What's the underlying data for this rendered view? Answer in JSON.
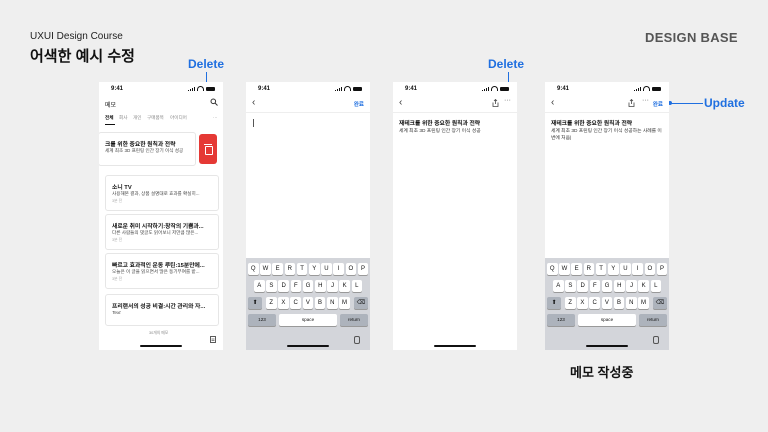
{
  "header": {
    "course": "UXUI Design Course",
    "title": "어색한 예시 수정",
    "brand": "DESIGN BASE"
  },
  "caption": "메모 작성중",
  "callouts": {
    "delete_1": "Delete",
    "delete_2": "Delete",
    "update": "Update"
  },
  "status_time": "9:41",
  "screen1": {
    "nav_title": "메모",
    "tabs": [
      "전체",
      "회사",
      "개인",
      "구매품목",
      "아이디어"
    ],
    "more": "···",
    "cards": [
      {
        "title": "크롤 위한 중요한 원칙과 전략",
        "body": "세계 최초 3D 프린팅 인간 장기 이식 성공"
      },
      {
        "title": "소니 TV",
        "body": "사용해본 결과, 상품 설명대로 효과를 확실히...",
        "date": "3분 전"
      },
      {
        "title": "새로운 취미 시작하기:창작의 기쁨과...",
        "body": "다른 사람들의 댓글도 읽어보니 저만큼 많은...",
        "date": "3분 전"
      },
      {
        "title": "빠르고 효과적인 운동 루틴:15분만에...",
        "body": "오늘은 이 글을 읽으면서 많은 동기부여를 받...",
        "date": "3분 전"
      },
      {
        "title": "프리랜서의 성공 비결:시간 관리와 자...",
        "body": "Text"
      }
    ],
    "footer_count": "30개의 메모"
  },
  "editor": {
    "done": "완료",
    "note_title": "재테크를 위한 중요한 원칙과 전략",
    "note_body_1": "세계 최초 3D 프린팅 인간 장기 이식 성공",
    "note_body_2": "세계 최초 3D 프린팅 인간 장기 이식 성공하는 사례를 이번에 처음|"
  },
  "keyboard": {
    "row1": [
      "Q",
      "W",
      "E",
      "R",
      "T",
      "Y",
      "U",
      "I",
      "O",
      "P"
    ],
    "row2": [
      "A",
      "S",
      "D",
      "F",
      "G",
      "H",
      "J",
      "K",
      "L"
    ],
    "row3": [
      "Z",
      "X",
      "C",
      "V",
      "B",
      "N",
      "M"
    ],
    "numbers": "123",
    "space": "space",
    "return": "return"
  },
  "colors": {
    "accent": "#1f6fe0",
    "delete_red": "#e53935",
    "background": "#efefef"
  }
}
